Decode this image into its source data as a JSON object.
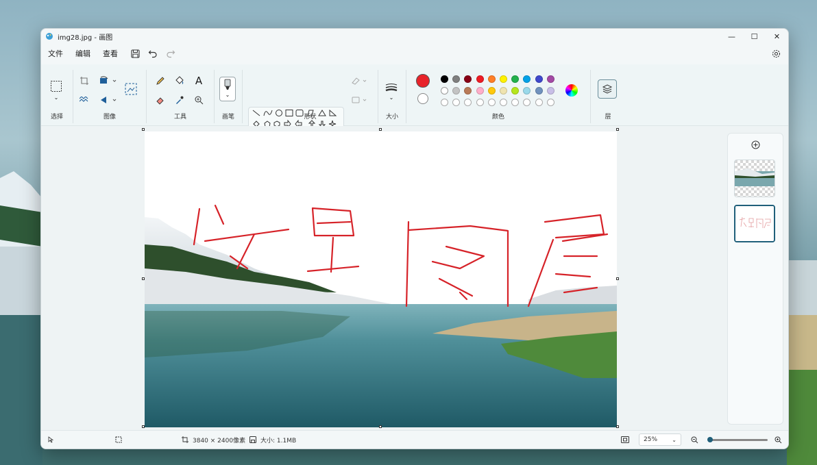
{
  "window": {
    "title": "img28.jpg - 画图",
    "minimize": "—",
    "maximize": "☐",
    "close": "✕"
  },
  "menu": {
    "file": "文件",
    "edit": "编辑",
    "view": "查看"
  },
  "ribbon": {
    "groups": {
      "select": "选择",
      "image": "图像",
      "tools": "工具",
      "brushes": "画笔",
      "shapes": "形状",
      "size": "大小",
      "colors": "颜色",
      "layers": "层"
    },
    "text_tool": "A",
    "active_color": "#e8232a",
    "secondary_color": "#ffffff",
    "palette_row1": [
      "#000000",
      "#7f7f7f",
      "#880015",
      "#ed1c24",
      "#ff7f27",
      "#fff200",
      "#22b14c",
      "#00a2e8",
      "#3f48cc",
      "#a349a4"
    ],
    "palette_row2": [
      "#ffffff",
      "#c3c3c3",
      "#b97a57",
      "#ffaec9",
      "#ffc90e",
      "#efe4b0",
      "#b5e61d",
      "#99d9ea",
      "#7092be",
      "#c8bfe7"
    ]
  },
  "canvas": {
    "handwriting_color": "#d62228"
  },
  "status": {
    "dimensions": "3840 × 2400像素",
    "size": "大小: 1.1MB",
    "zoom": "25%"
  }
}
